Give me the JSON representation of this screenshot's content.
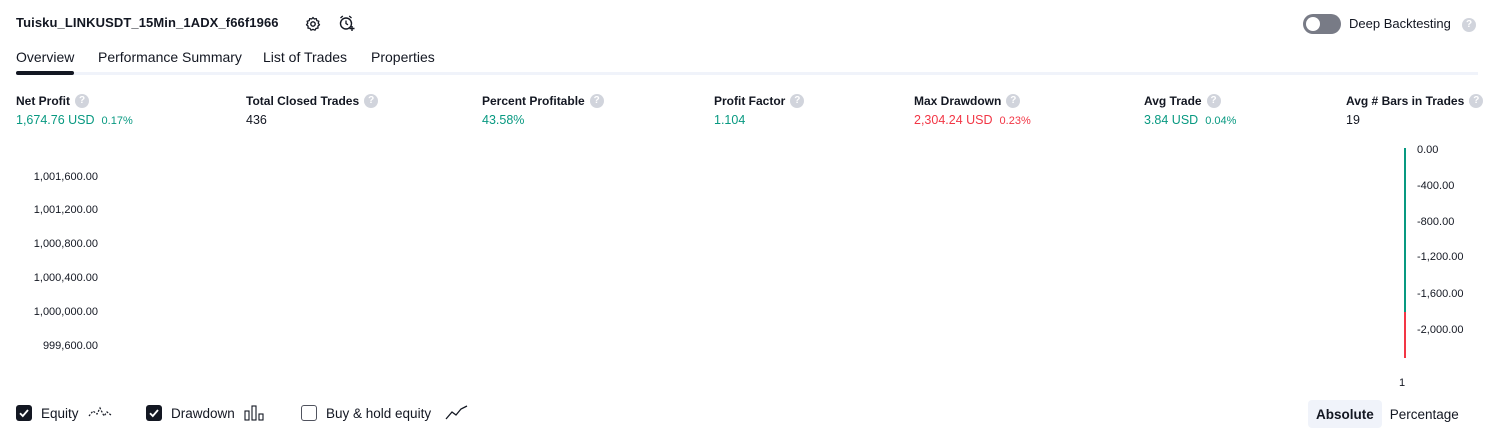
{
  "header": {
    "strategy_name": "Tuisku_LINKUSDT_15Min_1ADX_f66f1966",
    "settings_icon": "gear-icon",
    "alert_icon": "alarm-clock-plus-icon",
    "deep_backtesting_label": "Deep Backtesting",
    "deep_backtesting_enabled": false,
    "help_glyph": "?"
  },
  "tabs": [
    {
      "label": "Overview",
      "active": true
    },
    {
      "label": "Performance Summary",
      "active": false
    },
    {
      "label": "List of Trades",
      "active": false
    },
    {
      "label": "Properties",
      "active": false
    }
  ],
  "metrics": [
    {
      "label": "Net Profit",
      "value": "1,674.76 USD",
      "pct": "0.17%",
      "color": "#089981"
    },
    {
      "label": "Total Closed Trades",
      "value": "436",
      "pct": "",
      "color": "#131722"
    },
    {
      "label": "Percent Profitable",
      "value": "43.58%",
      "pct": "",
      "color": "#089981"
    },
    {
      "label": "Profit Factor",
      "value": "1.104",
      "pct": "",
      "color": "#089981"
    },
    {
      "label": "Max Drawdown",
      "value": "2,304.24 USD",
      "pct": "0.23%",
      "color": "#f23645"
    },
    {
      "label": "Avg Trade",
      "value": "3.84 USD",
      "pct": "0.04%",
      "color": "#089981"
    },
    {
      "label": "Avg # Bars in Trades",
      "value": "19",
      "pct": "",
      "color": "#131722"
    }
  ],
  "chart": {
    "left_axis": [
      "1,001,600.00",
      "1,001,200.00",
      "1,000,800.00",
      "1,000,400.00",
      "1,000,000.00",
      "999,600.00"
    ],
    "right_axis": [
      "0.00",
      "-400.00",
      "-800.00",
      "-1,200.00",
      "-1,600.00",
      "-2,000.00"
    ],
    "x_tick": "1",
    "drawdown_up_color": "#089981",
    "drawdown_down_color": "#f23645"
  },
  "legend": {
    "equity": {
      "label": "Equity",
      "checked": true,
      "icon": "equity-line-icon"
    },
    "drawdown": {
      "label": "Drawdown",
      "checked": true,
      "icon": "bars-icon"
    },
    "buy_hold": {
      "label": "Buy & hold equity",
      "checked": false,
      "icon": "trend-line-icon"
    }
  },
  "view_mode": {
    "absolute": "Absolute",
    "percentage": "Percentage",
    "active": "Absolute"
  }
}
